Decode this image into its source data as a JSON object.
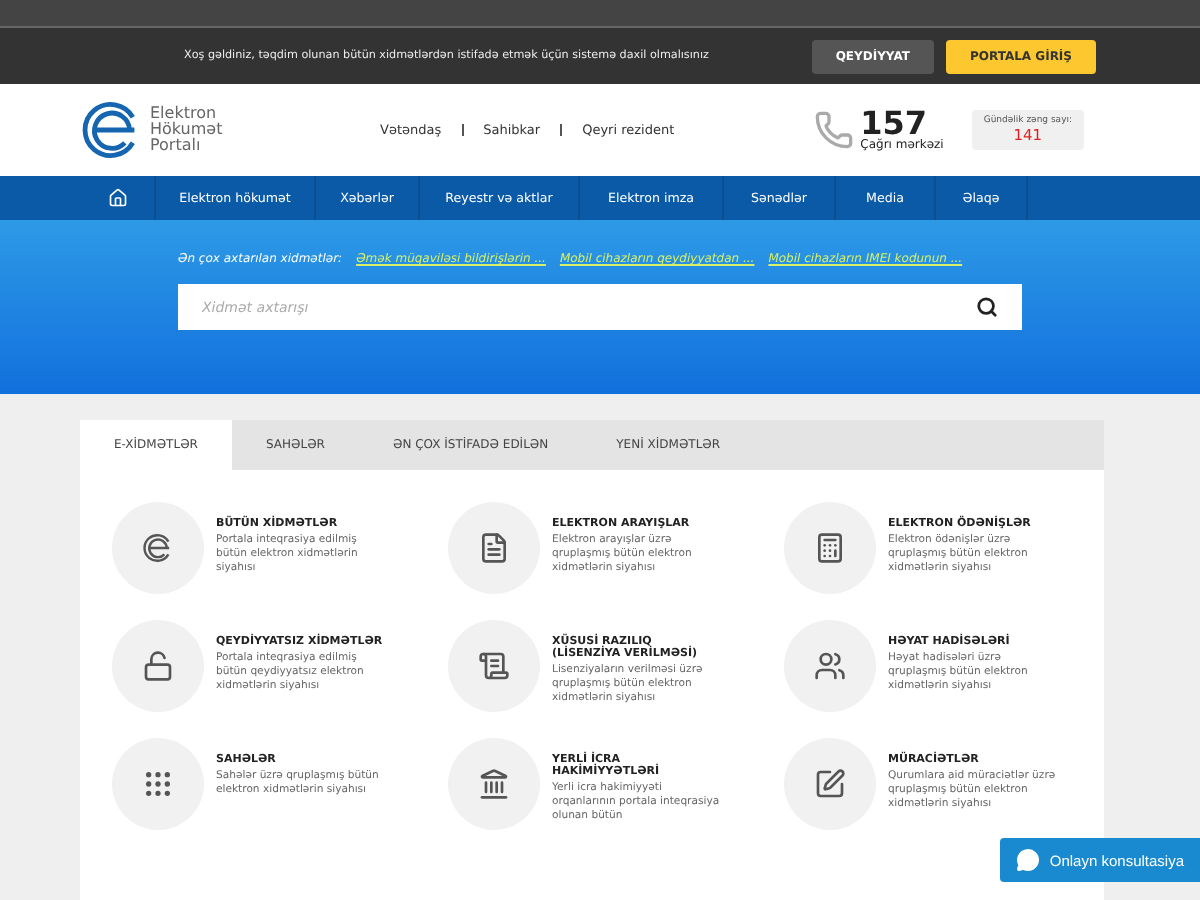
{
  "notice": {
    "text": "Xoş gəldiniz, təqdim olunan bütün xidmətlərdən istifadə etmək üçün sistemə daxil olmalısınız",
    "buttons": [
      {
        "label": "QEYDİYYAT",
        "kind": "secondary"
      },
      {
        "label": "PORTALA GİRİŞ",
        "kind": "primary"
      }
    ]
  },
  "logo": {
    "lines": [
      "Elektron",
      "Hökumət",
      "Portalı"
    ]
  },
  "audience": [
    "Vətəndaş",
    "Sahibkar",
    "Qeyri rezident"
  ],
  "call_center": {
    "number": "157",
    "label": "Çağrı mərkəzi",
    "daily_label": "Gündəlik zəng sayı:",
    "daily_count": "141"
  },
  "nav": [
    "Elektron hökumət",
    "Xəbərlər",
    "Reyestr və aktlar",
    "Elektron imza",
    "Sənədlər",
    "Media",
    "Əlaqə"
  ],
  "hero": {
    "popular_label": "Ən çox axtarılan xidmətlər:",
    "popular_links": [
      "Əmək müqaviləsi bildirişlərin ...",
      "Mobil cihazların qeydiyyatdan ...",
      "Mobil cihazların IMEI kodunun ..."
    ],
    "search": {
      "placeholder": "Xidmət axtarışı"
    }
  },
  "tabs": [
    {
      "label": "E-XİDMƏTLƏR",
      "selected": true
    },
    {
      "label": "SAHƏLƏR",
      "selected": false
    },
    {
      "label": "ƏN ÇOX İSTİFADƏ EDİLƏN",
      "selected": false
    },
    {
      "label": "YENİ XİDMƏTLƏR",
      "selected": false
    }
  ],
  "services": [
    {
      "kind": "egov",
      "title": "BÜTÜN XİDMƏTLƏR",
      "text": "Portala inteqrasiya edilmiş bütün elektron xidmətlərin siyahısı"
    },
    {
      "kind": "document",
      "title": "ELEKTRON ARAYIŞLAR",
      "text": "Elektron arayışlar üzrə qruplaşmış bütün elektron xidmətlərin siyahısı"
    },
    {
      "kind": "calculator",
      "title": "ELEKTRON ÖDƏNİŞLƏR",
      "text": "Elektron ödənişlər üzrə qruplaşmış bütün elektron xidmətlərin siyahısı"
    },
    {
      "kind": "lock",
      "title": "QEYDİYYATSIZ XİDMƏTLƏR",
      "text": "Portala inteqrasiya edilmiş bütün qeydiyyatsız elektron xidmətlərin siyahısı"
    },
    {
      "kind": "certificate",
      "title": "XÜSUSİ RAZILIQ (LİSENZİYA VERİLMƏSİ)",
      "text": "Lisenziyaların verilməsi üzrə qruplaşmış bütün elektron xidmətlərin siyahısı"
    },
    {
      "kind": "family",
      "title": "HƏYAT HADİSƏLƏRİ",
      "text": "Həyat hadisələri üzrə qruplaşmış bütün elektron xidmətlərin siyahısı"
    },
    {
      "kind": "grid",
      "title": "SAHƏLƏR",
      "text": "Sahələr üzrə qruplaşmış bütün elektron xidmətlərin siyahısı"
    },
    {
      "kind": "building",
      "title": "YERLİ İCRA HAKİMİYYƏTLƏRİ",
      "text": "Yerli icra hakimiyyəti orqanlarının portala inteqrasiya olunan bütün"
    },
    {
      "kind": "edit",
      "title": "MÜRACİƏTLƏR",
      "text": "Qurumlara aid müraciətlər üzrə qruplaşmış bütün elektron xidmətlərin siyahısı"
    }
  ],
  "chat": {
    "label": "Onlayn konsultasiya"
  }
}
